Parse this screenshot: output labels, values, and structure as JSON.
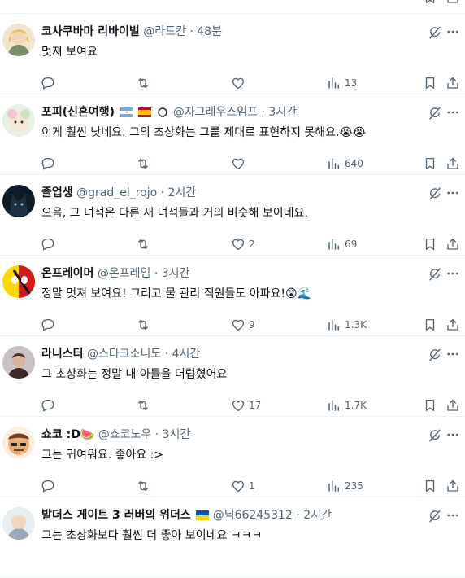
{
  "posts": [
    {
      "name": "코사쿠바마 리바이벌",
      "handle": "@라드칸",
      "dot": "·",
      "time": "48분",
      "text": "멋져 보여요",
      "likes": "",
      "views": "13"
    },
    {
      "name": "포피(신혼여행)",
      "handle": "@자그레우스임프",
      "dot": "·",
      "time": "3시간",
      "text": "이게 훨씬 낫네요. 그의 초상화는 그를 제대로 표현하지 못해요.😭😭",
      "likes": "",
      "views": "640"
    },
    {
      "name": "졸업생",
      "handle": "@grad_el_rojo",
      "dot": "·",
      "time": "2시간",
      "text": "으음, 그 녀석은 다른 새 녀석들과 거의 비슷해 보이네요.",
      "likes": "2",
      "views": "69"
    },
    {
      "name": "온프레이머",
      "handle": "@온프레임",
      "dot": "·",
      "time": "3시간",
      "text": "정말 멋져 보여요! 그리고 물 관리 직원들도 아파요!😲🌊",
      "likes": "9",
      "views": "1.3K"
    },
    {
      "name": "라니스터",
      "handle": "@스타크소니도",
      "dot": "·",
      "time": "4시간",
      "text": "그 초상화는 정말 내 아들을 더럽혔어요",
      "likes": "17",
      "views": "1.7K"
    },
    {
      "name": "쇼코 :D🍉",
      "handle": "@쇼코노우",
      "dot": "·",
      "time": "3시간",
      "text": "그는 귀여워요. 좋아요 :>",
      "likes": "1",
      "views": "235"
    },
    {
      "name": "발더스 게이트 3 러버의 위더스",
      "handle": "@닉66245312",
      "dot": "·",
      "time": "2시간",
      "text": "그는 초상화보다 훨씬 더 좋아 보이네요 ㅋㅋㅋ",
      "likes": "",
      "views": ""
    }
  ],
  "icons": {
    "reply": "reply-icon",
    "retweet": "retweet-icon",
    "like": "heart-icon",
    "views": "views-icon",
    "bookmark": "bookmark-icon",
    "share": "share-icon",
    "grok": "grok-icon",
    "more": "more-icon"
  },
  "colors": {
    "text": "#0f1419",
    "secondary": "#536471",
    "divider": "#eff3f4"
  }
}
